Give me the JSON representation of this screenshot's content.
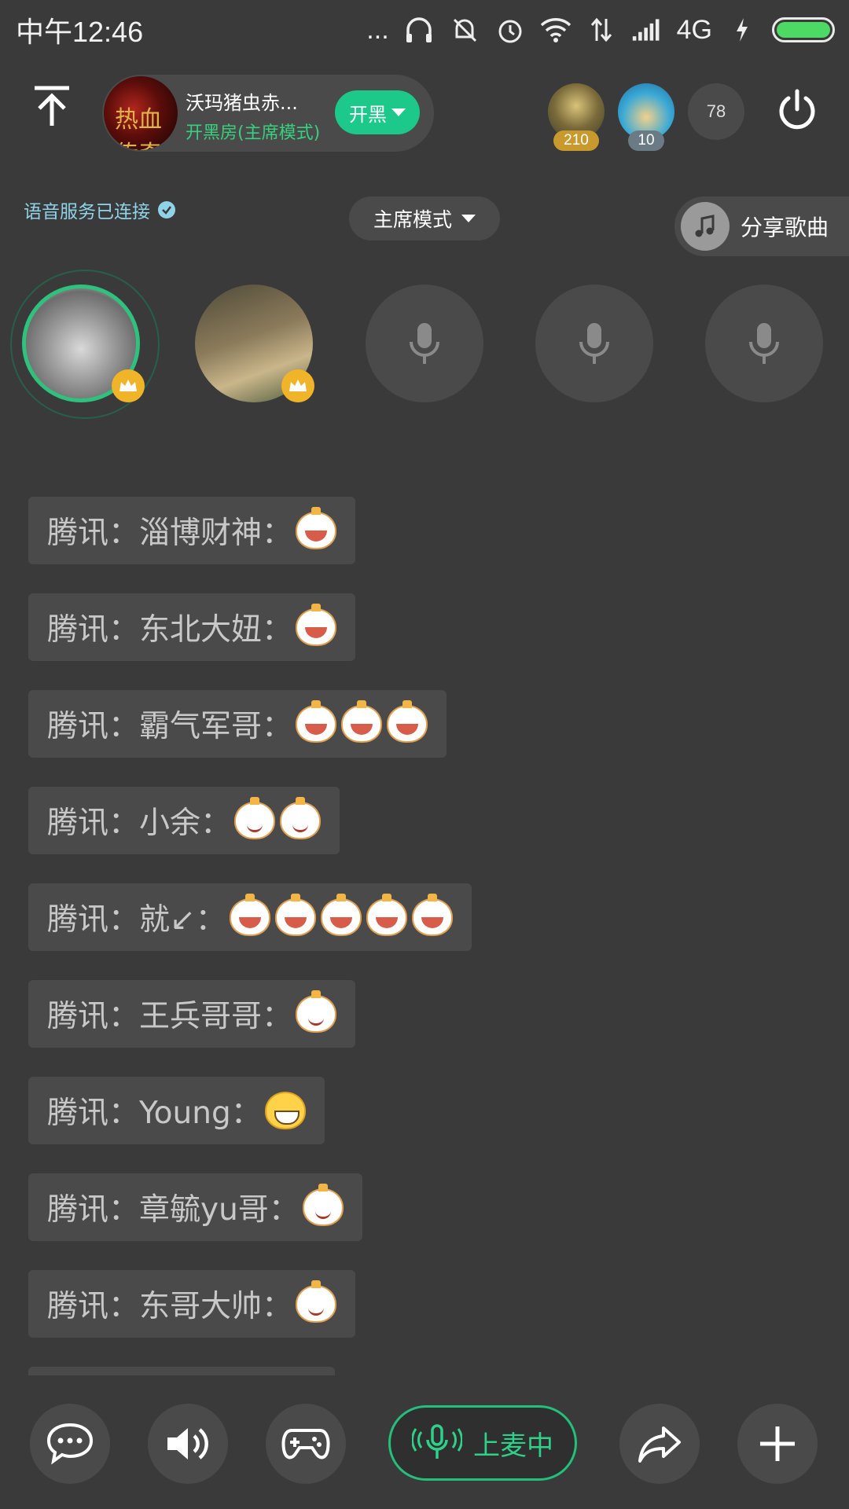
{
  "status_bar": {
    "time": "中午12:46",
    "network_label": "4G",
    "overflow": "..."
  },
  "header": {
    "room_name": "沃玛猪虫赤...",
    "room_mode": "开黑房(主席模式)",
    "room_avatar_text": "热血传奇",
    "kaihei_label": "开黑",
    "top_users": [
      {
        "badge": "210"
      },
      {
        "badge": "10"
      }
    ],
    "online_count": "78"
  },
  "subheader": {
    "voice_status": "语音服务已连接",
    "mode_label": "主席模式",
    "share_song_label": "分享歌曲"
  },
  "seats": [
    {
      "state": "occupied",
      "host": true
    },
    {
      "state": "occupied",
      "host": true
    },
    {
      "state": "empty"
    },
    {
      "state": "empty"
    },
    {
      "state": "empty"
    }
  ],
  "chat": {
    "messages": [
      {
        "text": "腾讯：淄博财神：",
        "emojis": [
          "grin"
        ]
      },
      {
        "text": "腾讯：东北大妞：",
        "emojis": [
          "grin"
        ]
      },
      {
        "text": "腾讯：霸气军哥：",
        "emojis": [
          "grin",
          "grin",
          "grin"
        ]
      },
      {
        "text": "腾讯：小余：",
        "emojis": [
          "smile",
          "smile"
        ]
      },
      {
        "text": "腾讯：就↙：",
        "emojis": [
          "grin",
          "grin",
          "grin",
          "grin",
          "grin"
        ]
      },
      {
        "text": "腾讯：王兵哥哥：",
        "emojis": [
          "smile"
        ]
      },
      {
        "text": "腾讯：Young：",
        "emojis": [
          "yellow-grin"
        ]
      },
      {
        "text": "腾讯：章毓yu哥：",
        "emojis": [
          "smile"
        ]
      },
      {
        "text": "腾讯：东哥大帅：",
        "emojis": [
          "smile"
        ]
      }
    ]
  },
  "bottom_bar": {
    "mic_label": "上麦中"
  },
  "colors": {
    "background": "#3a3a3a",
    "card": "#4a4a4a",
    "accent_green": "#1dc98a",
    "host_crown": "#f0b429"
  }
}
